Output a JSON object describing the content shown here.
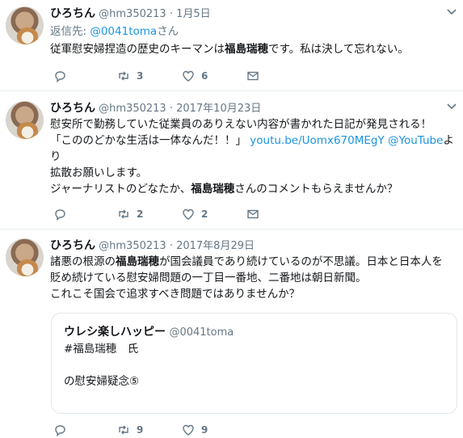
{
  "tweets": [
    {
      "name": "ひろちん",
      "handle": "@hm350213",
      "time": "1月5日",
      "reply_prefix": "返信先: ",
      "reply_to": "@0041toma",
      "reply_suffix": "さん",
      "body_line1_pre": "従軍慰安婦捏造の歴史のキーマンは",
      "body_line1_bold": "福島瑞穂",
      "body_line1_post": "です。私は決して忘れない。",
      "reply_count": "",
      "retweet_count": "3",
      "like_count": "6"
    },
    {
      "name": "ひろちん",
      "handle": "@hm350213",
      "time": "2017年10月23日",
      "line1": "慰安所で勤務していた従業員のありえない内容が書かれた日記が発見される！",
      "line2_text": "「こののどかな生活は一体なんだ！！」",
      "line2_link1": "youtu.be/Uomx670MEgY",
      "line2_link2": "@YouTube",
      "line2_tail": "よ",
      "line3": "り",
      "line4": "拡散お願いします。",
      "line5_pre": "ジャーナリストのどなたか、",
      "line5_bold": "福島瑞穂",
      "line5_post": "さんのコメントもらえませんか？",
      "reply_count": "",
      "retweet_count": "2",
      "like_count": "2"
    },
    {
      "name": "ひろちん",
      "handle": "@hm350213",
      "time": "2017年8月29日",
      "line1_pre": "諸悪の根源の",
      "line1_bold": "福島瑞穂",
      "line1_post": "が国会議員であり続けているのが不思議。日本と日本人を",
      "line2": "貶め続けている慰安婦問題の一丁目一番地、二番地は朝日新聞。",
      "line3": "これこそ国会で追求すべき問題ではありませんか？",
      "quote": {
        "name": "ウレシ楽しハッピー",
        "handle": "@0041toma",
        "line1": "#福島瑞穂　氏",
        "line2": "の慰安婦疑念⑤"
      },
      "reply_count": "",
      "retweet_count": "9",
      "like_count": "9"
    }
  ],
  "icons": [
    "reply-icon",
    "retweet-icon",
    "like-icon",
    "message-icon",
    "chevron-down-icon"
  ],
  "colors": {
    "link": "#1b95e0",
    "muted": "#657786",
    "border": "#e6ecf0"
  }
}
